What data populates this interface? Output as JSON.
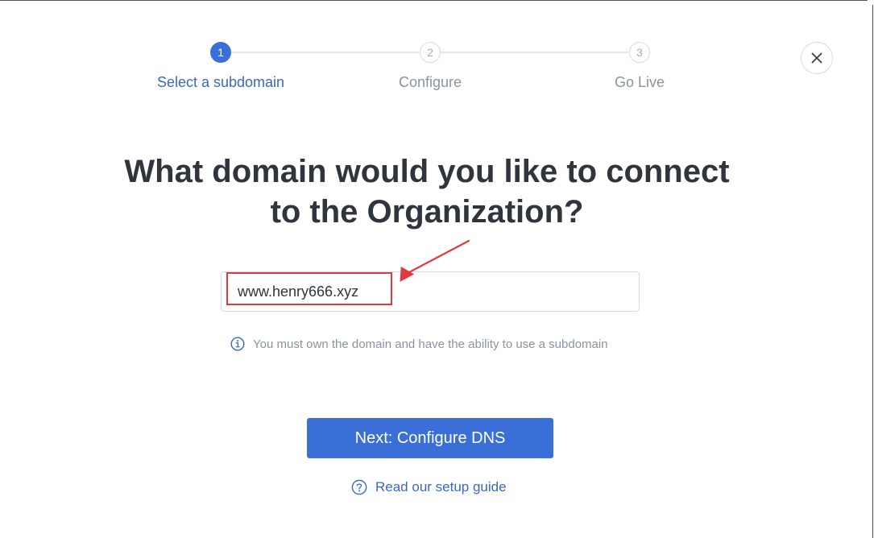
{
  "stepper": {
    "steps": [
      {
        "number": "1",
        "label": "Select a subdomain",
        "state": "active"
      },
      {
        "number": "2",
        "label": "Configure",
        "state": "inactive"
      },
      {
        "number": "3",
        "label": "Go Live",
        "state": "inactive"
      }
    ]
  },
  "close": {
    "icon": "close-icon"
  },
  "main": {
    "heading_line1": "What domain would you like to connect",
    "heading_line2": "to the Organization?",
    "domain_value": "www.henry666.xyz",
    "hint_icon": "info-icon",
    "hint_text": "You must own the domain and have the ability to use a subdomain",
    "next_label": "Next: Configure DNS",
    "guide_icon": "question-circle-icon",
    "guide_label": "Read our setup guide"
  },
  "colors": {
    "accent": "#3b6fd8",
    "heading": "#30353d",
    "muted": "#8a939f",
    "annotation": "#e5383b"
  }
}
